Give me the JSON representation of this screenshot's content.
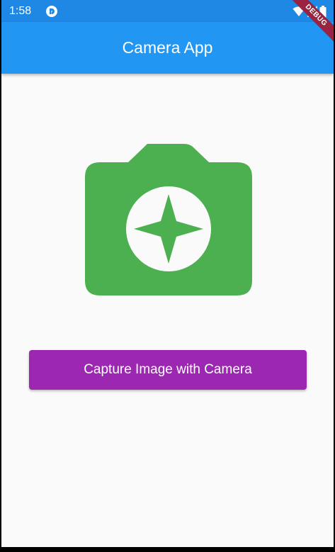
{
  "status_bar": {
    "time": "1:58",
    "icons": [
      "app-notification-icon",
      "wifi-icon",
      "signal-icon",
      "battery-icon"
    ]
  },
  "app_bar": {
    "title": "Camera App"
  },
  "debug_banner": {
    "label": "DEBUG"
  },
  "main": {
    "icon": "camera-icon",
    "capture_button_label": "Capture Image with Camera"
  },
  "colors": {
    "status_bar": "#1f88e5",
    "app_bar": "#2196f3",
    "camera_icon": "#4caf50",
    "capture_button": "#9c27b0",
    "background": "#fafafa",
    "debug_ribbon": "#9b2342"
  }
}
